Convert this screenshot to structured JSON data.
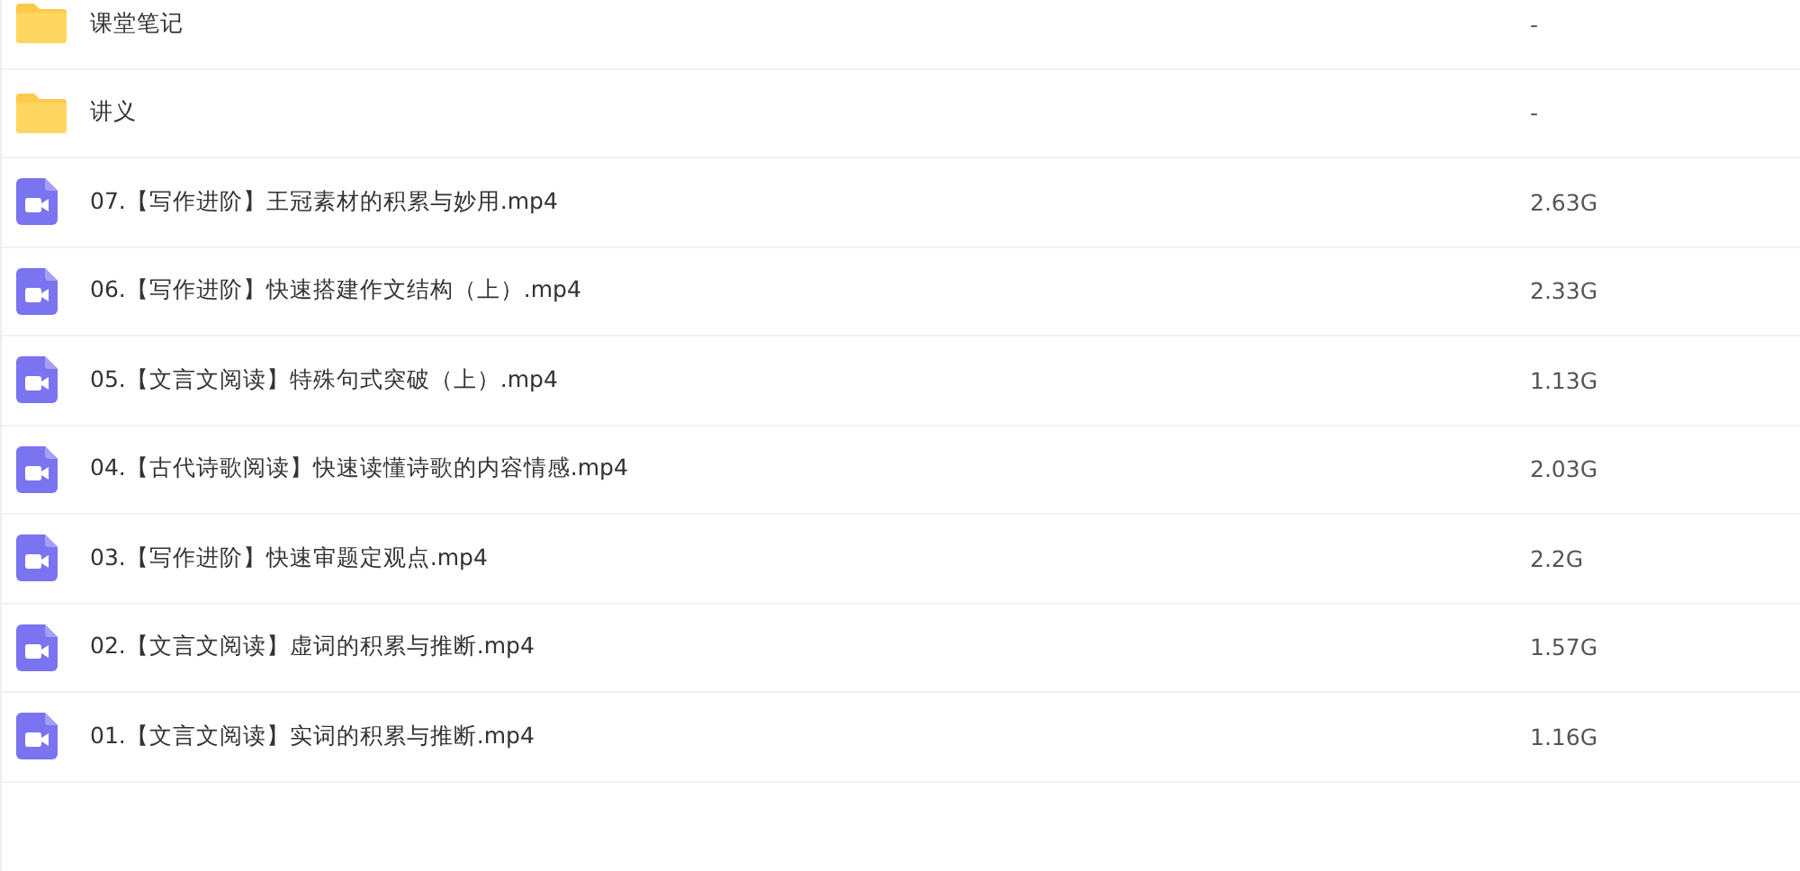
{
  "files": [
    {
      "kind": "folder",
      "name": "课堂笔记",
      "size": "-"
    },
    {
      "kind": "folder",
      "name": "讲义",
      "size": "-"
    },
    {
      "kind": "video",
      "name": "07.【写作进阶】王冠素材的积累与妙用.mp4",
      "size": "2.63G"
    },
    {
      "kind": "video",
      "name": "06.【写作进阶】快速搭建作文结构（上）.mp4",
      "size": "2.33G"
    },
    {
      "kind": "video",
      "name": "05.【文言文阅读】特殊句式突破（上）.mp4",
      "size": "1.13G"
    },
    {
      "kind": "video",
      "name": "04.【古代诗歌阅读】快速读懂诗歌的内容情感.mp4",
      "size": "2.03G"
    },
    {
      "kind": "video",
      "name": "03.【写作进阶】快速审题定观点.mp4",
      "size": "2.2G"
    },
    {
      "kind": "video",
      "name": "02.【文言文阅读】虚词的积累与推断.mp4",
      "size": "1.57G"
    },
    {
      "kind": "video",
      "name": "01.【文言文阅读】实词的积累与推断.mp4",
      "size": "1.16G"
    }
  ]
}
